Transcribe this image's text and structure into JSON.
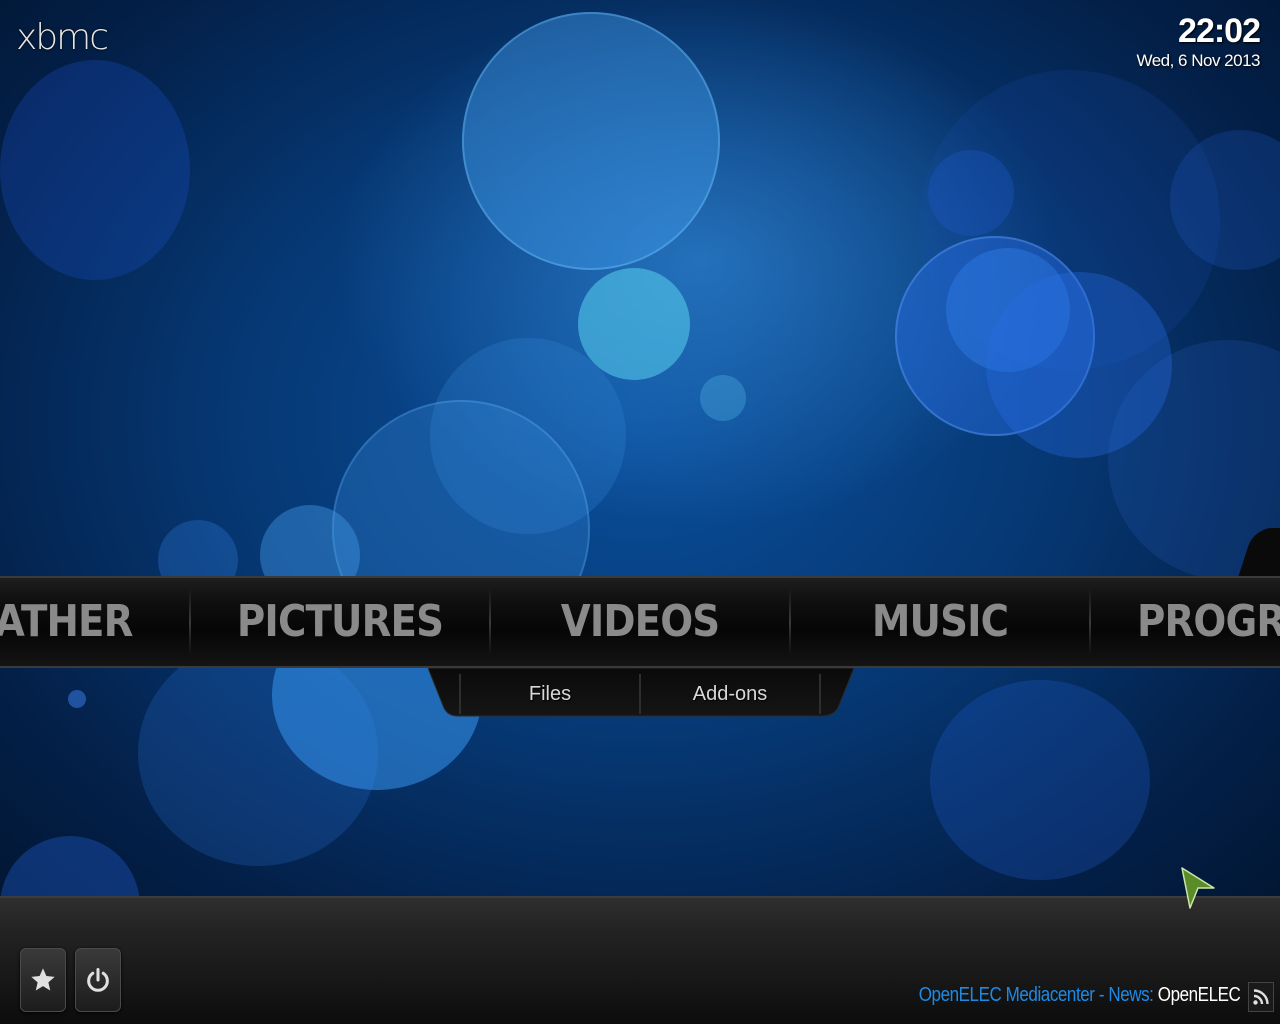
{
  "app": {
    "logo_text": "xbmc"
  },
  "clock": {
    "time": "22:02",
    "date": "Wed, 6 Nov 2013"
  },
  "main_menu": {
    "items": [
      {
        "label": "WEATHER"
      },
      {
        "label": "PICTURES"
      },
      {
        "label": "VIDEOS"
      },
      {
        "label": "MUSIC"
      },
      {
        "label": "PROGRAMS"
      }
    ],
    "selected": "VIDEOS"
  },
  "submenu": {
    "items": [
      {
        "label": "Files"
      },
      {
        "label": "Add-ons"
      }
    ]
  },
  "bottom_bar": {
    "favourites_icon": "star-icon",
    "power_icon": "power-icon",
    "rss_icon": "rss-icon"
  },
  "news_ticker": {
    "source": "OpenELEC Mediacenter - News:",
    "headline": "OpenELEC"
  },
  "colors": {
    "accent": "#1e8ae6",
    "menu_text": "#8a8a8a",
    "bar_bg": "#0e0e0e"
  }
}
